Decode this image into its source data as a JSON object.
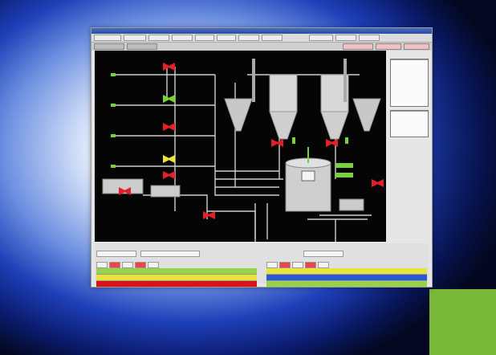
{
  "colors": {
    "alarm_yellow": "#e8e43a",
    "alarm_green": "#96d24a",
    "alarm_red": "#d8141a",
    "alarm_blue": "#2a5ad0",
    "valve_red": "#e0202a",
    "valve_green": "#7ad23a",
    "corner_green": "#7ab83a"
  },
  "icons": [
    "valve-icon",
    "pump-icon",
    "silo-icon",
    "mixer-tank-icon"
  ],
  "window": {
    "title": "",
    "toolbar": [],
    "nav": []
  },
  "station_panels": [
    {
      "title": "",
      "lines": []
    },
    {
      "title": "",
      "lines": []
    }
  ],
  "bottom": {
    "left_panel": {
      "tabs": [],
      "alarm_colors": [
        "#96d24a",
        "#e8e43a",
        "#d8141a"
      ]
    },
    "right_panel": {
      "tabs": [],
      "alarm_colors": [
        "#e8e43a",
        "#2a5ad0",
        "#96d24a"
      ]
    }
  }
}
